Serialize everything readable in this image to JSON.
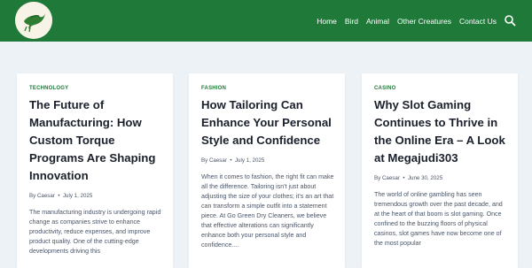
{
  "header": {
    "logo_icon": "bird-logo-icon",
    "bg_color": "#1f7a3a",
    "nav": [
      "Home",
      "Bird",
      "Animal",
      "Other Creatures",
      "Contact Us"
    ],
    "search_icon": "search-icon"
  },
  "posts": [
    {
      "category": "TECHNOLOGY",
      "title": "The Future of Manufacturing: How Custom Torque Programs Are Shaping Innovation",
      "author": "By Caesar",
      "date": "July 1, 2025",
      "excerpt": "The manufacturing industry is undergoing rapid change as companies strive to enhance productivity, reduce expenses, and improve product quality. One of the cutting-edge developments driving this"
    },
    {
      "category": "FASHION",
      "title": "How Tailoring Can Enhance Your Personal Style and Confidence",
      "author": "By Caesar",
      "date": "July 1, 2025",
      "excerpt": "When it comes to fashion, the right fit can make all the difference. Tailoring isn't just about adjusting the size of your clothes; it's an art that can transform a simple outfit into a statement piece. At Go Green Dry Cleaners, we believe that effective alterations can significantly enhance both your personal style and confidence...."
    },
    {
      "category": "CASINO",
      "title": "Why Slot Gaming Continues to Thrive in the Online Era – A Look at Megajudi303",
      "author": "By Caesar",
      "date": "June 30, 2025",
      "excerpt": "The world of online gambling has seen tremendous growth over the past decade, and at the heart of that boom is slot gaming. Once confined to the buzzing floors of physical casinos, slot games have now become one of the most popular"
    }
  ]
}
